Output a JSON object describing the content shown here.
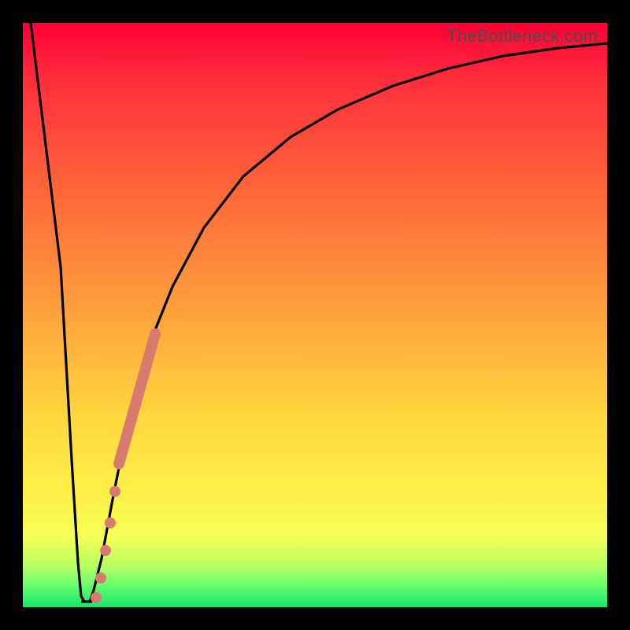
{
  "watermark": "TheBottleneck.com",
  "colors": {
    "curve_stroke": "#000000",
    "marker_fill": "#d87a6e",
    "frame": "#000000"
  },
  "chart_data": {
    "type": "line",
    "title": "",
    "xlabel": "",
    "ylabel": "",
    "xlim": [
      0,
      100
    ],
    "ylim": [
      0,
      100
    ],
    "curve": {
      "x": [
        0,
        3,
        5,
        7,
        9,
        10,
        11,
        12,
        14,
        16,
        18,
        20,
        22,
        25,
        30,
        35,
        40,
        50,
        60,
        70,
        80,
        90,
        100
      ],
      "y": [
        100,
        65,
        35,
        10,
        1,
        0.5,
        1,
        3,
        10,
        20,
        30,
        38,
        45,
        55,
        67,
        75,
        80,
        87,
        91,
        93.5,
        95,
        96,
        96.5
      ]
    },
    "markers": {
      "salmon_thick_segment": {
        "x_start": 15.5,
        "x_end": 20.5,
        "y_start": 27,
        "y_end": 46
      },
      "salmon_dots": [
        {
          "x": 14.8,
          "y": 22
        },
        {
          "x": 14.0,
          "y": 17
        },
        {
          "x": 13.2,
          "y": 12
        },
        {
          "x": 12.4,
          "y": 7
        },
        {
          "x": 11.6,
          "y": 3
        }
      ]
    },
    "annotations": []
  }
}
